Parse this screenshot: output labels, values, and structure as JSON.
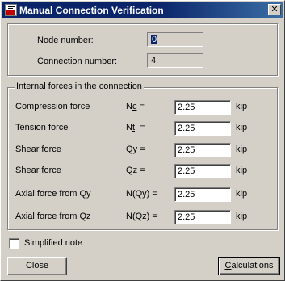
{
  "window": {
    "title": "Manual Connection Verification",
    "close_glyph": "✕"
  },
  "ids": {
    "node_label_u": "N",
    "node_label_rest": "ode number:",
    "node_value": "0",
    "conn_label_u": "C",
    "conn_label_rest": "onnection number:",
    "conn_value": "4"
  },
  "forces": {
    "group_title": "Internal forces in the connection",
    "rows": [
      {
        "name": "Compression force",
        "sym_a": "N",
        "sym_u": "c",
        "sym_b": " =",
        "value": "2.25",
        "unit": "kip"
      },
      {
        "name": "Tension force",
        "sym_a": "N",
        "sym_u": "t",
        "sym_b": "  =",
        "value": "2.25",
        "unit": "kip"
      },
      {
        "name": "Shear force",
        "sym_a": "Q",
        "sym_u": "y",
        "sym_b": " =",
        "value": "2.25",
        "unit": "kip"
      },
      {
        "name": "Shear force",
        "sym_a": "",
        "sym_u": "Q",
        "sym_b": "z =",
        "value": "2.25",
        "unit": "kip"
      },
      {
        "name": "Axial force from Qy",
        "sym_a": "N(Qy) =",
        "sym_u": "",
        "sym_b": "",
        "value": "2.25",
        "unit": "kip"
      },
      {
        "name": "Axial force from Qz",
        "sym_a": "N(Qz) =",
        "sym_u": "",
        "sym_b": "",
        "value": "2.25",
        "unit": "kip"
      }
    ]
  },
  "simplified_note": {
    "label": "Simplified note",
    "checked": false
  },
  "buttons": {
    "close": "Close",
    "calc_u": "C",
    "calc_rest": "alculations"
  }
}
